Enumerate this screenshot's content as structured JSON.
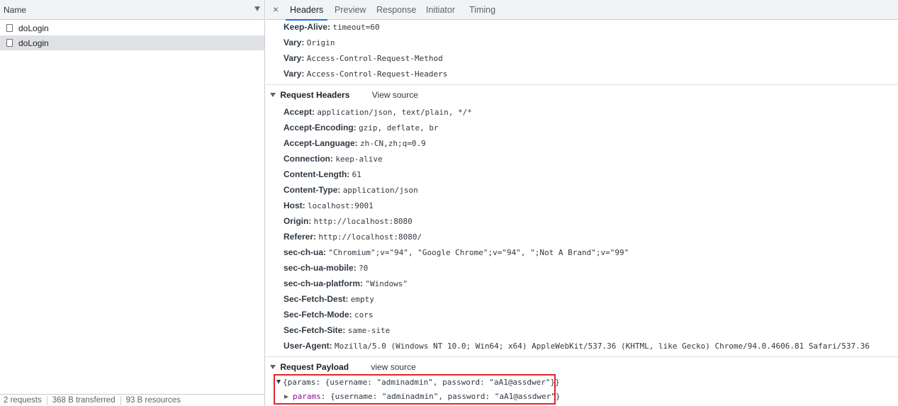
{
  "left_pane": {
    "header_label": "Name",
    "requests": [
      {
        "name": "doLogin",
        "selected": false
      },
      {
        "name": "doLogin",
        "selected": true
      }
    ],
    "footer": {
      "requests": "2 requests",
      "transferred": "368 B transferred",
      "resources": "93 B resources"
    }
  },
  "tabs": [
    "Headers",
    "Preview",
    "Response",
    "Initiator",
    "Timing"
  ],
  "active_tab": "Headers",
  "close_glyph": "×",
  "response_headers": [
    {
      "key": "Keep-Alive:",
      "value": "timeout=60"
    },
    {
      "key": "Vary:",
      "value": "Origin"
    },
    {
      "key": "Vary:",
      "value": "Access-Control-Request-Method"
    },
    {
      "key": "Vary:",
      "value": "Access-Control-Request-Headers"
    }
  ],
  "request_headers_section": {
    "title": "Request Headers",
    "view_source": "View source"
  },
  "request_headers": [
    {
      "key": "Accept:",
      "value": "application/json, text/plain, */*"
    },
    {
      "key": "Accept-Encoding:",
      "value": "gzip, deflate, br"
    },
    {
      "key": "Accept-Language:",
      "value": "zh-CN,zh;q=0.9"
    },
    {
      "key": "Connection:",
      "value": "keep-alive"
    },
    {
      "key": "Content-Length:",
      "value": "61"
    },
    {
      "key": "Content-Type:",
      "value": "application/json"
    },
    {
      "key": "Host:",
      "value": "localhost:9001"
    },
    {
      "key": "Origin:",
      "value": "http://localhost:8080"
    },
    {
      "key": "Referer:",
      "value": "http://localhost:8080/"
    },
    {
      "key": "sec-ch-ua:",
      "value": "\"Chromium\";v=\"94\", \"Google Chrome\";v=\"94\", \";Not A Brand\";v=\"99\""
    },
    {
      "key": "sec-ch-ua-mobile:",
      "value": "?0"
    },
    {
      "key": "sec-ch-ua-platform:",
      "value": "\"Windows\""
    },
    {
      "key": "Sec-Fetch-Dest:",
      "value": "empty"
    },
    {
      "key": "Sec-Fetch-Mode:",
      "value": "cors"
    },
    {
      "key": "Sec-Fetch-Site:",
      "value": "same-site"
    },
    {
      "key": "User-Agent:",
      "value": "Mozilla/5.0 (Windows NT 10.0; Win64; x64) AppleWebKit/537.36 (KHTML, like Gecko) Chrome/94.0.4606.81 Safari/537.36"
    }
  ],
  "payload_section": {
    "title": "Request Payload",
    "view_source": "view source"
  },
  "payload": {
    "summary": "{params: {username: \"adminadmin\", password: \"aA1@assdwer\"}}",
    "child_key": "params",
    "child_colon": ":",
    "child_value": "{username: \"adminadmin\", password: \"aA1@assdwer\"}"
  },
  "colors": {
    "accent": "#1a73e8",
    "highlight_box": "#e0262a",
    "selected_row": "#dfe1e5",
    "header_bg": "#f1f3f4"
  }
}
